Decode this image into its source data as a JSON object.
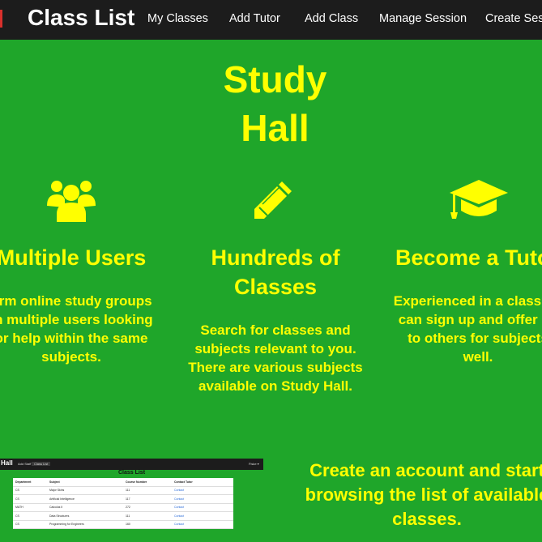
{
  "navbar": {
    "brand": "Class List",
    "links": [
      "My Classes",
      "Add Tutor",
      "Add Class",
      "Manage Session",
      "Create Sess"
    ]
  },
  "hero": {
    "title_line1": "Study",
    "title_line2": "Hall"
  },
  "features": [
    {
      "icon": "users-icon",
      "title": "Multiple Users",
      "text": [
        "orm online study groups",
        "th multiple users looking",
        "or help within the same",
        "subjects."
      ]
    },
    {
      "icon": "pencil-icon",
      "title": [
        "Hundreds of",
        "Classes"
      ],
      "text": [
        "Search for classes and",
        "subjects relevant to you.",
        "There are various subjects",
        "available on Study Hall."
      ]
    },
    {
      "icon": "graduation-cap-icon",
      "title": "Become a Tuto",
      "text": [
        "Experienced in a class? Y",
        "can sign up and offer he",
        "to others for subjects",
        "well."
      ]
    }
  ],
  "preview": {
    "brand": "Hall",
    "links": [
      "Add Staff",
      "Class List"
    ],
    "right_link": "Fiske ▾",
    "title": "Class List",
    "columns": [
      "Department",
      "Subject",
      "Course Number",
      "Contact Tutor"
    ],
    "rows": [
      [
        "CS",
        "Major Skins",
        "111",
        "Contact"
      ],
      [
        "CS",
        "Artificial Intelligence",
        "117",
        "Contact"
      ],
      [
        "MATH",
        "Calculus II",
        "272",
        "Contact"
      ],
      [
        "CS",
        "Data Structures",
        "111",
        "Contact"
      ],
      [
        "CS",
        "Programming for Engineers",
        "160",
        "Contact"
      ]
    ]
  },
  "cta": {
    "lines": [
      "Create an account and start",
      "browsing the list of available",
      "classes."
    ]
  },
  "colors": {
    "background": "#1fa62a",
    "accent_text": "#ffff00",
    "navbar": "#1c1c1c"
  }
}
